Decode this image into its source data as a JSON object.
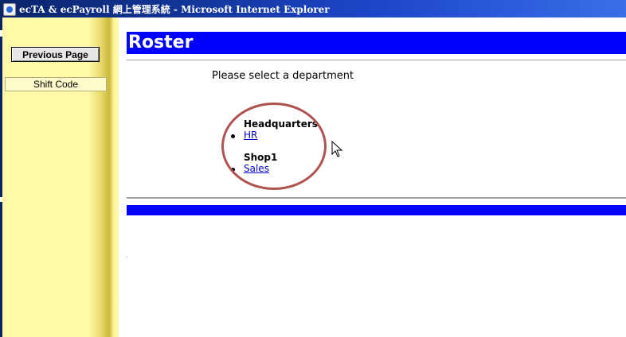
{
  "window": {
    "title": "ecTA & ecPayroll 網上管理系統 - Microsoft Internet Explorer"
  },
  "sidebar": {
    "previous_page_label": "Previous Page",
    "shift_code_label": "Shift Code"
  },
  "main": {
    "title": "Roster",
    "prompt": "Please select a department",
    "groups": [
      {
        "name": "Headquarters",
        "departments": [
          "HR"
        ]
      },
      {
        "name": "Shop1",
        "departments": [
          "Sales"
        ]
      }
    ]
  },
  "colors": {
    "title_bar": "#0a246a",
    "banner": "#0000ff",
    "sidebar": "#fff9a8",
    "link": "#0000cc",
    "annotation": "#b05252"
  }
}
